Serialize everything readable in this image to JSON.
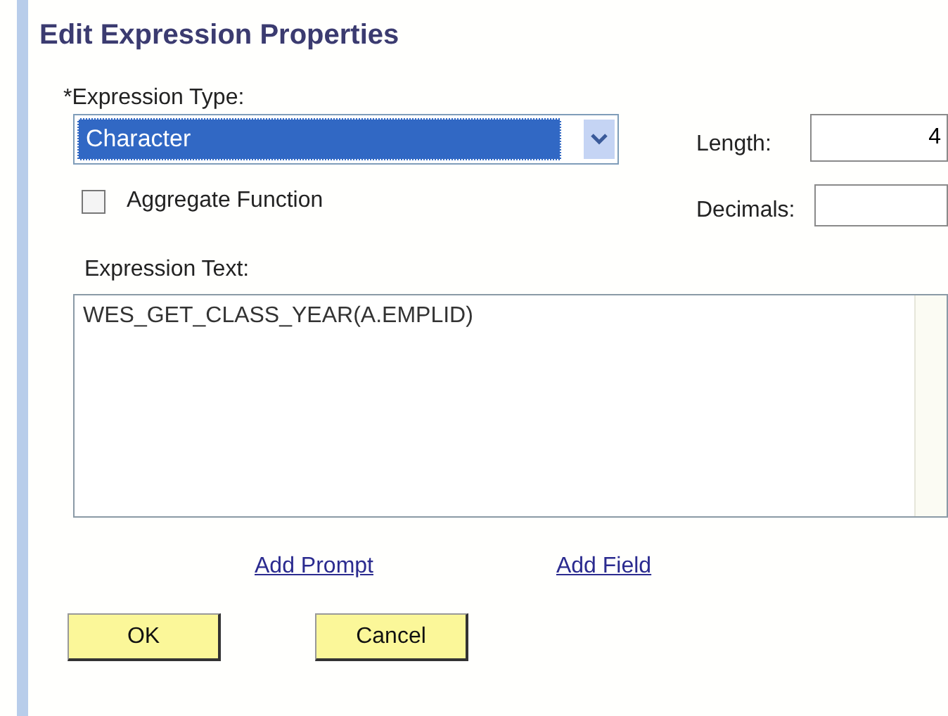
{
  "title": "Edit Expression Properties",
  "expression_type": {
    "label": "*Expression Type:",
    "value": "Character",
    "focused": true
  },
  "length": {
    "label": "Length:",
    "value": "4"
  },
  "aggregate_function": {
    "label": "Aggregate Function",
    "checked": false
  },
  "decimals": {
    "label": "Decimals:"
  },
  "expression_text": {
    "label": "Expression Text:",
    "value": "WES_GET_CLASS_YEAR(A.EMPLID)"
  },
  "links": [
    "Add Prompt",
    "Add Field"
  ],
  "buttons": [
    "OK",
    "Cancel"
  ]
}
